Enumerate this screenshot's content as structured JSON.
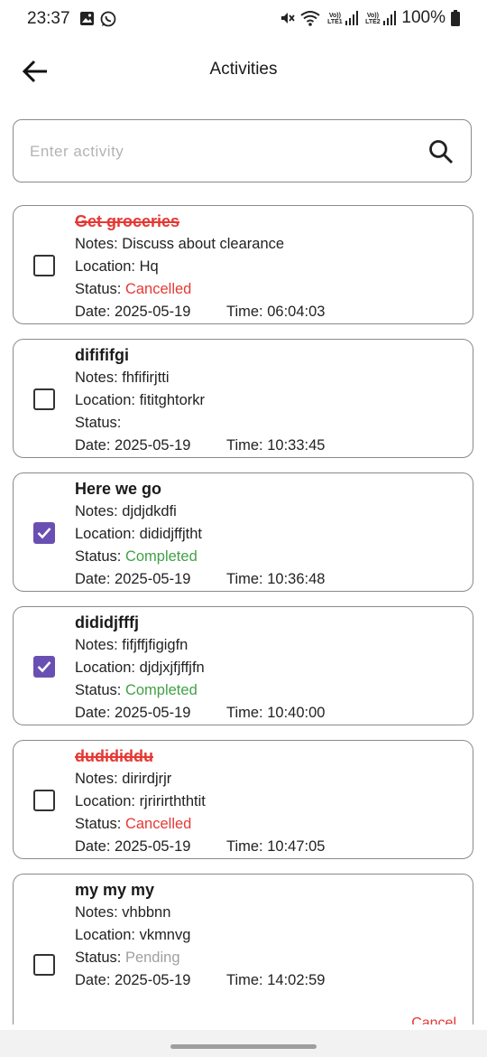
{
  "status_bar": {
    "time": "23:37",
    "battery": "100%",
    "sim1": "Vo)) LTE1",
    "sim2": "Vo)) LTE2"
  },
  "appbar": {
    "title": "Activities"
  },
  "search": {
    "placeholder": "Enter activity",
    "value": ""
  },
  "labels": {
    "notes": "Notes: ",
    "location": "Location: ",
    "status": "Status: ",
    "date": "Date: ",
    "time": "Time: "
  },
  "activities": [
    {
      "title": "Get groceries",
      "notes": "Discuss about clearance",
      "location": "Hq",
      "status": "Cancelled",
      "date": "2025-05-19",
      "time": "06:04:03",
      "checked": false
    },
    {
      "title": "difififgi",
      "notes": "fhfifirjtti",
      "location": "fititghtorkr",
      "status": "",
      "date": "2025-05-19",
      "time": "10:33:45",
      "checked": false
    },
    {
      "title": "Here we go",
      "notes": "djdjdkdfi",
      "location": "dididjffjtht",
      "status": "Completed",
      "date": "2025-05-19",
      "time": "10:36:48",
      "checked": true
    },
    {
      "title": "dididjfffj",
      "notes": "fifjffjfigigfn",
      "location": "djdjxjfjffjfn",
      "status": "Completed",
      "date": "2025-05-19",
      "time": "10:40:00",
      "checked": true
    },
    {
      "title": "dudididdu",
      "notes": "dirirdjrjr",
      "location": "rjririrththtit",
      "status": "Cancelled",
      "date": "2025-05-19",
      "time": "10:47:05",
      "checked": false
    },
    {
      "title": "my my my",
      "notes": "vhbbnn",
      "location": "vkmnvg",
      "status": "Pending",
      "date": "2025-05-19",
      "time": "14:02:59",
      "checked": false,
      "action": "Cancel"
    }
  ],
  "colors": {
    "accent": "#6a4fb3",
    "cancelled": "#e53935",
    "completed": "#43a047",
    "pending": "#a0a0a0"
  },
  "icons": [
    "image-icon",
    "whatsapp-icon",
    "mute-icon",
    "wifi-icon",
    "signal-icon",
    "battery-icon",
    "back-arrow-icon",
    "search-icon",
    "checkmark-icon"
  ]
}
